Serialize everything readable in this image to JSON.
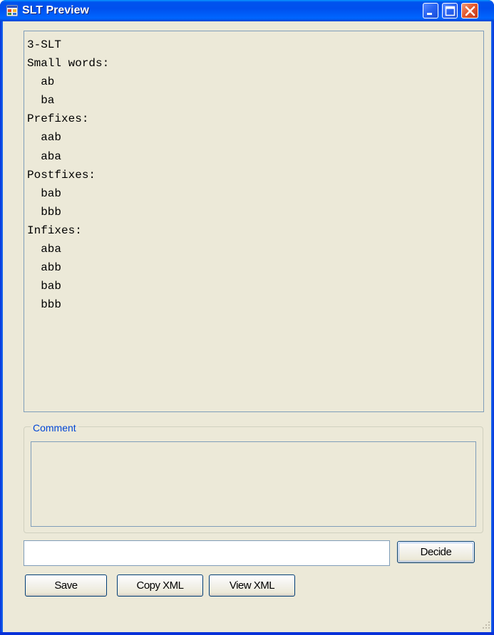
{
  "window": {
    "title": "SLT Preview",
    "icon": "application-window-icon"
  },
  "caption_buttons": [
    "minimize-icon",
    "maximize-icon",
    "close-icon"
  ],
  "preview": {
    "lines": [
      "3-SLT",
      "Small words:",
      "  ab",
      "  ba",
      "Prefixes:",
      "  aab",
      "  aba",
      "Postfixes:",
      "  bab",
      "  bbb",
      "Infixes:",
      "  aba",
      "  abb",
      "  bab",
      "  bbb"
    ]
  },
  "comment": {
    "label": "Comment",
    "value": ""
  },
  "decide": {
    "input_value": "",
    "button_label": "Decide"
  },
  "actions": {
    "save_label": "Save",
    "copy_xml_label": "Copy XML",
    "view_xml_label": "View XML"
  },
  "colors": {
    "titlebar": "#0053ee",
    "client_background": "#ece9d8",
    "groupbox_label": "#0046d5",
    "border": "#7f9db9"
  }
}
